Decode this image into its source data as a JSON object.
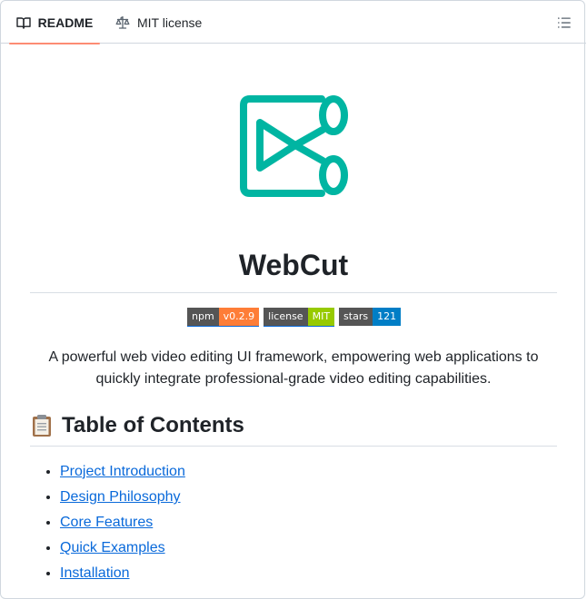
{
  "tabs": {
    "readme_label": "README",
    "license_label": "MIT license"
  },
  "icons": {
    "readme": "book-icon",
    "license": "scale-icon",
    "outline": "list-outline-icon",
    "logo": "webcut-logo-icon",
    "clipboard": "clipboard-icon"
  },
  "colors": {
    "accent_tab": "#fd8c73",
    "logo": "#00b5a2",
    "link": "#0969da"
  },
  "readme": {
    "title": "WebCut",
    "badges": [
      {
        "label": "npm",
        "value": "v0.2.9",
        "color": "#fe7d37"
      },
      {
        "label": "license",
        "value": "MIT",
        "color": "#97ca00"
      },
      {
        "label": "stars",
        "value": "121",
        "color": "#007ec6"
      }
    ],
    "description": "A powerful web video editing UI framework, empowering web applications to quickly integrate professional-grade video editing capabilities.",
    "toc_heading": "Table of Contents",
    "toc_items": [
      "Project Introduction",
      "Design Philosophy",
      "Core Features",
      "Quick Examples",
      "Installation"
    ]
  }
}
